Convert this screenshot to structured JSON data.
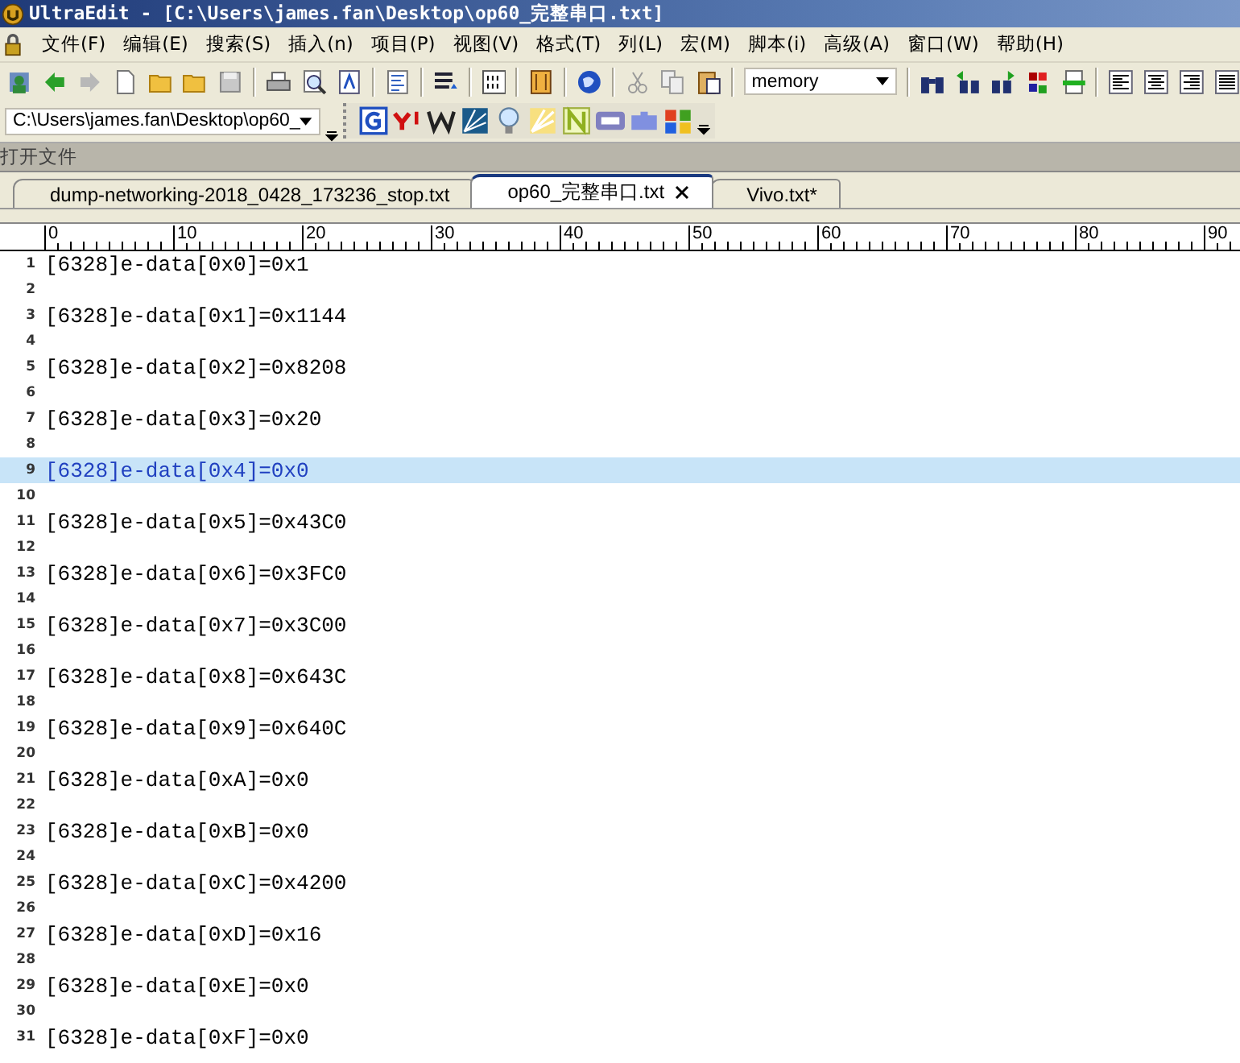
{
  "window": {
    "title": "UltraEdit - [C:\\Users\\james.fan\\Desktop\\op60_完整串口.txt]"
  },
  "menu": [
    "文件(F)",
    "编辑(E)",
    "搜索(S)",
    "插入(n)",
    "项目(P)",
    "视图(V)",
    "格式(T)",
    "列(L)",
    "宏(M)",
    "脚本(i)",
    "高级(A)",
    "窗口(W)",
    "帮助(H)"
  ],
  "toolbar": {
    "search_combo": "memory"
  },
  "address_bar": {
    "path": "C:\\Users\\james.fan\\Desktop\\op60_"
  },
  "panel": {
    "title": "打开文件"
  },
  "tabs": [
    {
      "label": "dump-networking-2018_0428_173236_stop.txt",
      "selected": false
    },
    {
      "label": "op60_完整串口.txt",
      "selected": true
    },
    {
      "label": "Vivo.txt*",
      "selected": false
    }
  ],
  "ruler": [
    "0",
    "10",
    "20",
    "30",
    "40",
    "50",
    "60",
    "70",
    "80",
    "90"
  ],
  "lines": [
    {
      "number": "1",
      "text": "[6328]e-data[0x0]=0x1",
      "current": false
    },
    {
      "number": "2",
      "current": false
    },
    {
      "number": "3",
      "text": "[6328]e-data[0x1]=0x1144",
      "current": false
    },
    {
      "number": "4",
      "current": false
    },
    {
      "number": "5",
      "text": "[6328]e-data[0x2]=0x8208",
      "current": false
    },
    {
      "number": "6",
      "current": false
    },
    {
      "number": "7",
      "text": "[6328]e-data[0x3]=0x20",
      "current": false
    },
    {
      "number": "8",
      "current": false
    },
    {
      "number": "9",
      "text": "[6328]e-data[0x4]=0x0",
      "current": true
    },
    {
      "number": "10",
      "current": false
    },
    {
      "number": "11",
      "text": "[6328]e-data[0x5]=0x43C0",
      "current": false
    },
    {
      "number": "12",
      "current": false
    },
    {
      "number": "13",
      "text": "[6328]e-data[0x6]=0x3FC0",
      "current": false
    },
    {
      "number": "14",
      "current": false
    },
    {
      "number": "15",
      "text": "[6328]e-data[0x7]=0x3C00",
      "current": false
    },
    {
      "number": "16",
      "current": false
    },
    {
      "number": "17",
      "text": "[6328]e-data[0x8]=0x643C",
      "current": false
    },
    {
      "number": "18",
      "current": false
    },
    {
      "number": "19",
      "text": "[6328]e-data[0x9]=0x640C",
      "current": false
    },
    {
      "number": "20",
      "current": false
    },
    {
      "number": "21",
      "text": "[6328]e-data[0xA]=0x0",
      "current": false
    },
    {
      "number": "22",
      "current": false
    },
    {
      "number": "23",
      "text": "[6328]e-data[0xB]=0x0",
      "current": false
    },
    {
      "number": "24",
      "current": false
    },
    {
      "number": "25",
      "text": "[6328]e-data[0xC]=0x4200",
      "current": false
    },
    {
      "number": "26",
      "current": false
    },
    {
      "number": "27",
      "text": "[6328]e-data[0xD]=0x16",
      "current": false
    },
    {
      "number": "28",
      "current": false
    },
    {
      "number": "29",
      "text": "[6328]e-data[0xE]=0x0",
      "current": false
    },
    {
      "number": "30",
      "current": false
    },
    {
      "number": "31",
      "text": "[6328]e-data[0xF]=0x0",
      "current": false
    }
  ]
}
